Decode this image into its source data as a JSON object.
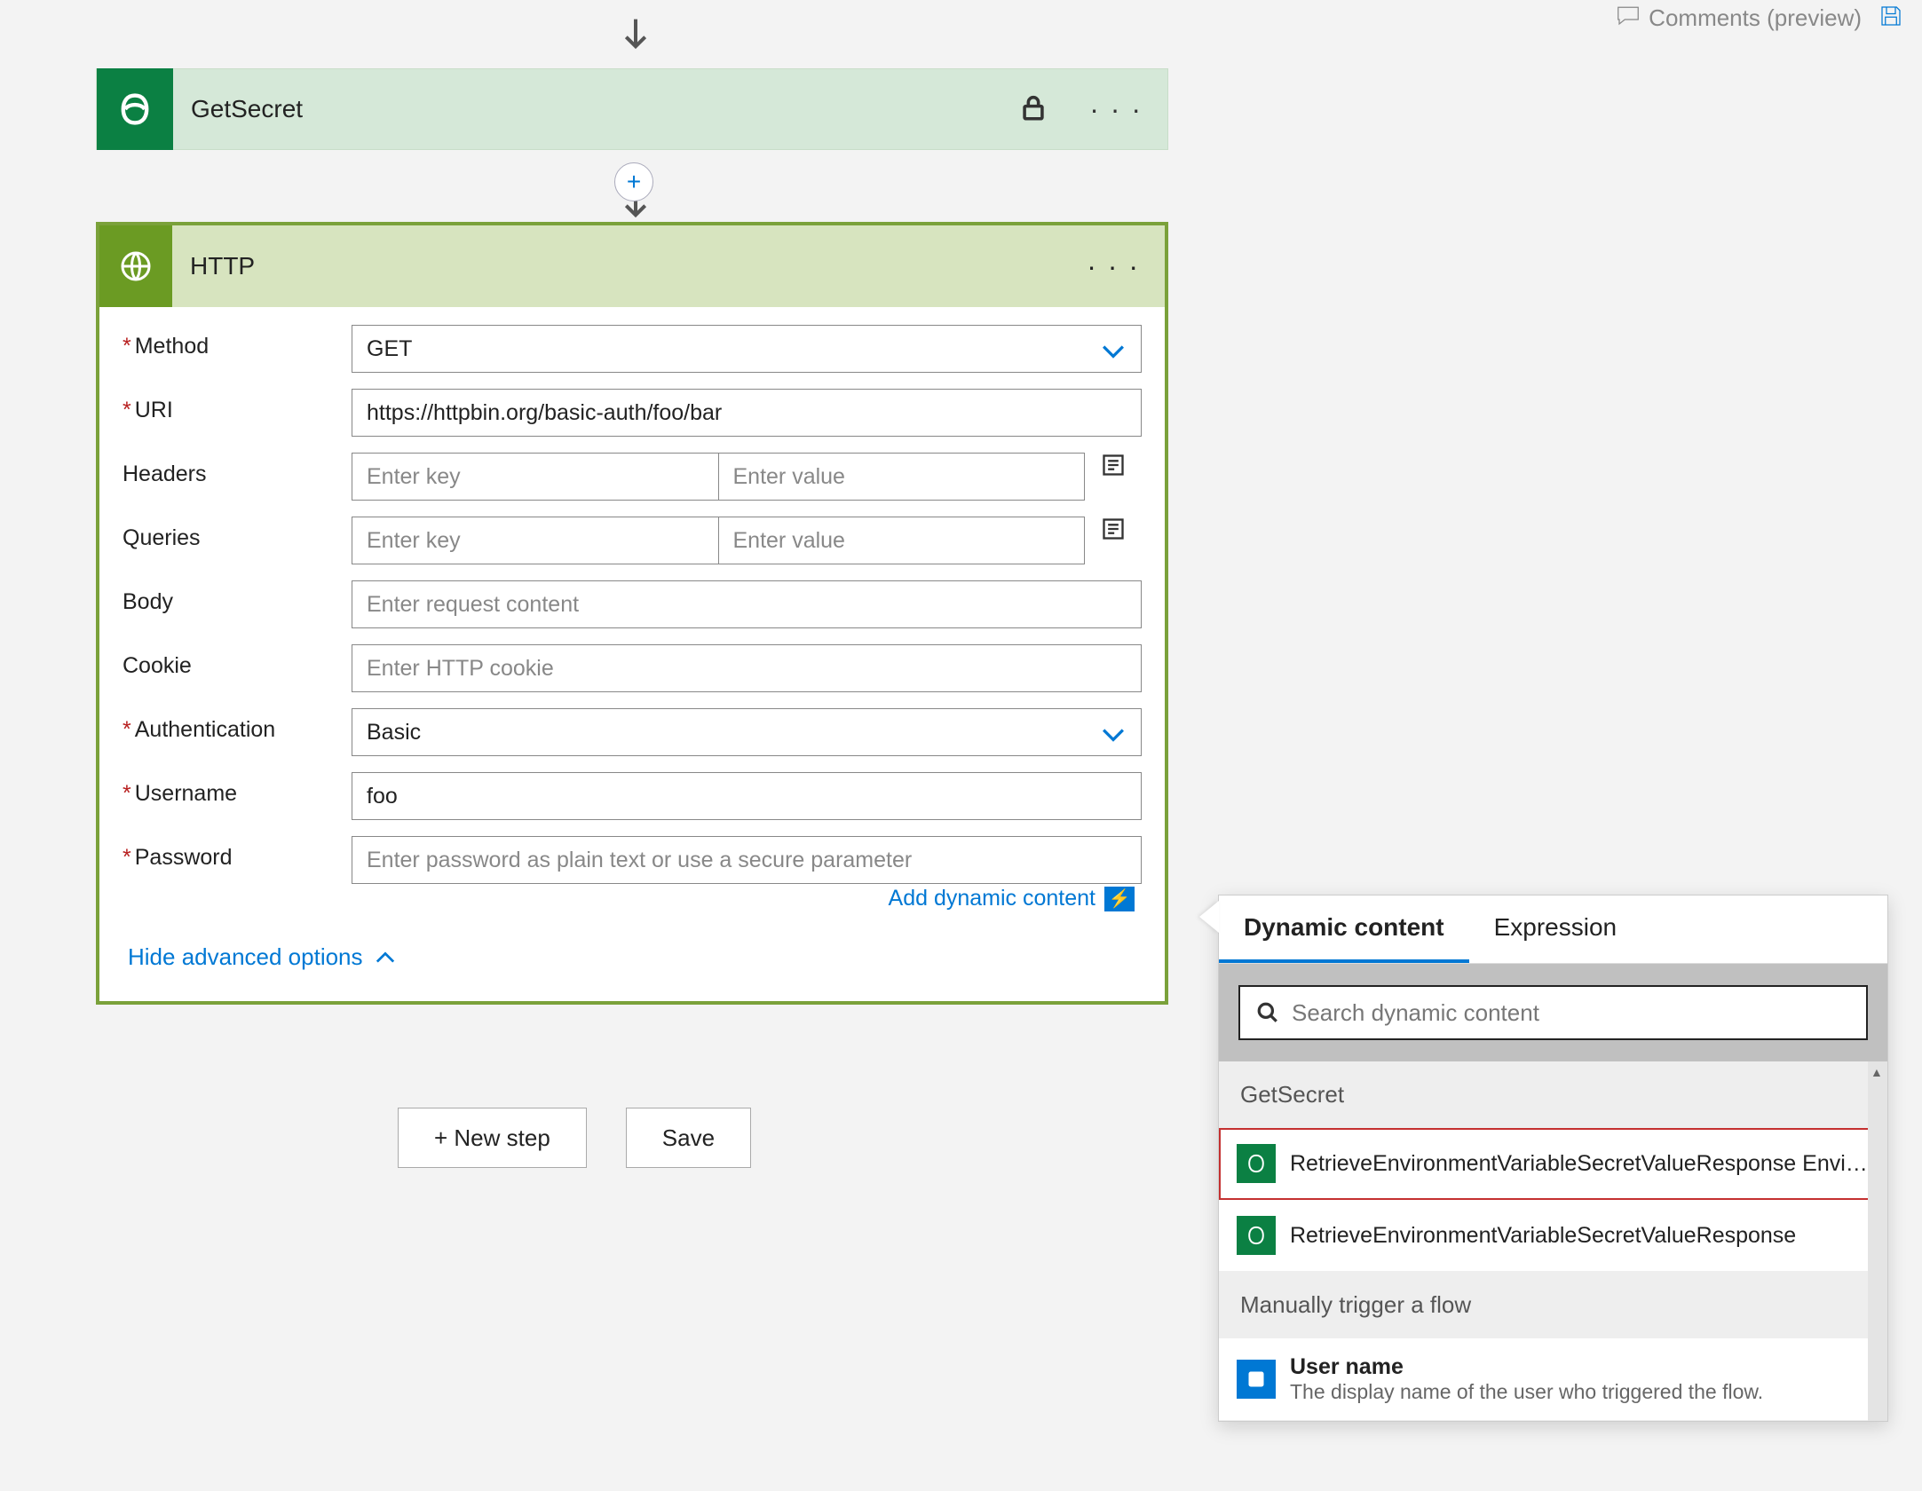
{
  "toolbar": {
    "comments_label": "Comments (preview)"
  },
  "actions": {
    "getsecret": {
      "title": "GetSecret"
    },
    "http": {
      "title": "HTTP",
      "labels": {
        "method": "Method",
        "uri": "URI",
        "headers": "Headers",
        "queries": "Queries",
        "body": "Body",
        "cookie": "Cookie",
        "authentication": "Authentication",
        "username": "Username",
        "password": "Password"
      },
      "values": {
        "method": "GET",
        "uri": "https://httpbin.org/basic-auth/foo/bar",
        "authentication": "Basic",
        "username": "foo"
      },
      "placeholders": {
        "header_key": "Enter key",
        "header_value": "Enter value",
        "query_key": "Enter key",
        "query_value": "Enter value",
        "body": "Enter request content",
        "cookie": "Enter HTTP cookie",
        "password": "Enter password as plain text or use a secure parameter"
      },
      "add_dynamic_label": "Add dynamic content",
      "hide_advanced_label": "Hide advanced options"
    }
  },
  "buttons": {
    "new_step": "+ New step",
    "save": "Save"
  },
  "dynpanel": {
    "tabs": {
      "dynamic": "Dynamic content",
      "expression": "Expression"
    },
    "search_placeholder": "Search dynamic content",
    "sections": {
      "getsecret": "GetSecret",
      "manual": "Manually trigger a flow"
    },
    "items": {
      "retrieve1": "RetrieveEnvironmentVariableSecretValueResponse Envi…",
      "retrieve2": "RetrieveEnvironmentVariableSecretValueResponse",
      "user_name_title": "User name",
      "user_name_desc": "The display name of the user who triggered the flow."
    }
  }
}
